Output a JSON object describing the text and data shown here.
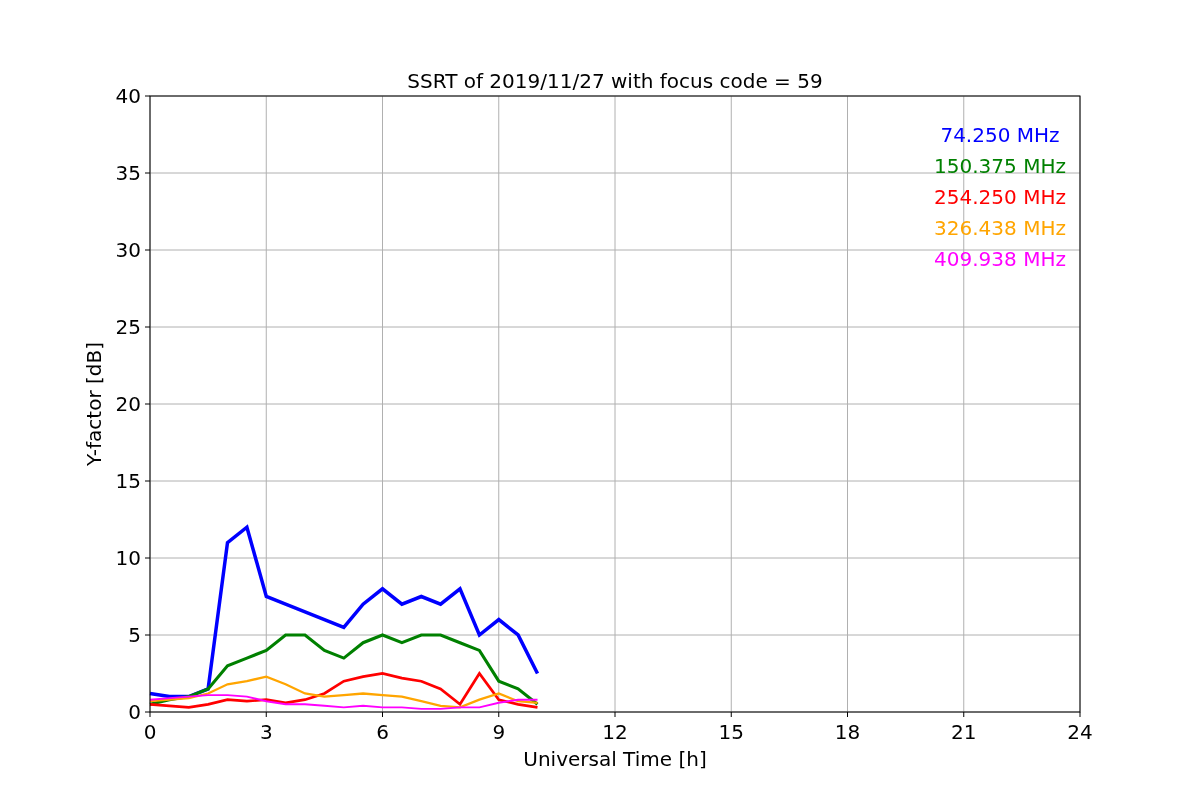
{
  "chart_data": {
    "type": "line",
    "title": "SSRT of 2019/11/27 with focus code = 59",
    "xlabel": "Universal Time [h]",
    "ylabel": "Y-factor [dB]",
    "x": [
      0,
      0.5,
      1,
      1.5,
      2,
      2.5,
      3,
      3.5,
      4,
      4.5,
      5,
      5.5,
      6,
      6.5,
      7,
      7.5,
      8,
      8.5,
      9,
      9.5,
      10
    ],
    "series": [
      {
        "name": "74.250 MHz",
        "color": "#0000ff",
        "values": [
          1.2,
          1.0,
          1.0,
          1.5,
          11,
          12,
          7.5,
          7,
          6.5,
          6,
          5.5,
          7,
          8,
          7,
          7.5,
          7,
          8,
          5,
          6,
          5,
          2.5
        ]
      },
      {
        "name": "150.375 MHz",
        "color": "#008000",
        "values": [
          0.5,
          0.8,
          1,
          1.5,
          3,
          3.5,
          4,
          5,
          5,
          4,
          3.5,
          4.5,
          5,
          4.5,
          5,
          5,
          4.5,
          4,
          2,
          1.5,
          0.5
        ]
      },
      {
        "name": "254.250 MHz",
        "color": "#ff0000",
        "values": [
          0.5,
          0.4,
          0.3,
          0.5,
          0.8,
          0.7,
          0.8,
          0.6,
          0.8,
          1.2,
          2,
          2.3,
          2.5,
          2.2,
          2,
          1.5,
          0.5,
          2.5,
          0.8,
          0.5,
          0.3
        ]
      },
      {
        "name": "326.438 MHz",
        "color": "#ffa500",
        "values": [
          0.7,
          0.8,
          0.9,
          1.2,
          1.8,
          2,
          2.3,
          1.8,
          1.2,
          1.0,
          1.1,
          1.2,
          1.1,
          1.0,
          0.7,
          0.4,
          0.3,
          0.8,
          1.2,
          0.7,
          0.6
        ]
      },
      {
        "name": "409.938 MHz",
        "color": "#ff00ff",
        "values": [
          0.8,
          0.9,
          1,
          1.1,
          1.1,
          1.0,
          0.7,
          0.5,
          0.5,
          0.4,
          0.3,
          0.4,
          0.3,
          0.3,
          0.2,
          0.2,
          0.3,
          0.3,
          0.6,
          0.8,
          0.8
        ]
      }
    ],
    "xlim": [
      0,
      24
    ],
    "ylim": [
      0,
      40
    ],
    "xticks": [
      0,
      3,
      6,
      9,
      12,
      15,
      18,
      21,
      24
    ],
    "yticks": [
      0,
      5,
      10,
      15,
      20,
      25,
      30,
      35,
      40
    ],
    "grid": true
  }
}
